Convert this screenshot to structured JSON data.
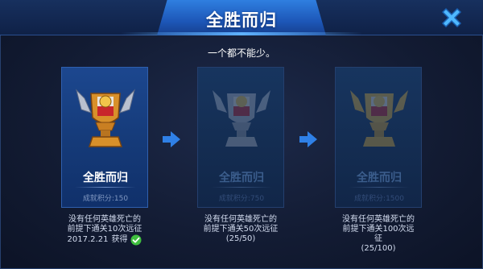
{
  "header": {
    "title": "全胜而归"
  },
  "subtitle": "一个都不能少。",
  "achievements": [
    {
      "name": "全胜而归",
      "points": "成就积分:150",
      "desc_line1": "没有任何英雄死亡的",
      "desc_line2": "前提下通关10次远征",
      "date": "2017.2.21",
      "status": "获得",
      "status_icon": "check-circle-icon",
      "tier_color": "#d8902a"
    },
    {
      "name": "全胜而归",
      "points": "成就积分:750",
      "desc_line1": "没有任何英雄死亡的",
      "desc_line2": "前提下通关50次远征",
      "progress": "(25/50)",
      "tier_color": "#b8bcc8"
    },
    {
      "name": "全胜而归",
      "points": "成就积分:1500",
      "desc_line1": "没有任何英雄死亡的",
      "desc_line2": "前提下通关100次远",
      "desc_line3": "征",
      "progress": "(25/100)",
      "tier_color": "#e8b438"
    }
  ],
  "icons": {
    "close": "close-icon",
    "arrow": "arrow-right-icon"
  },
  "colors": {
    "accent": "#2f7fe0",
    "close": "#4fb8ff",
    "check": "#3fbf3f"
  }
}
